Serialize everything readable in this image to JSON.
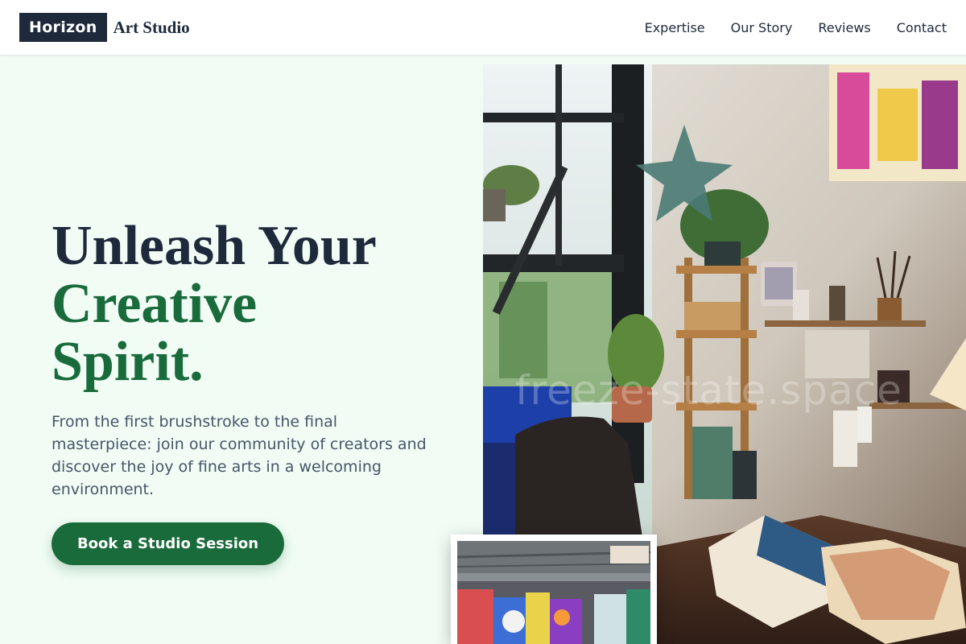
{
  "brand": {
    "name_box": "Horizon",
    "name_text": "Art Studio"
  },
  "nav": {
    "items": [
      {
        "label": "Expertise"
      },
      {
        "label": "Our Story"
      },
      {
        "label": "Reviews"
      },
      {
        "label": "Contact"
      }
    ]
  },
  "hero": {
    "headline_line1": "Unleash Your",
    "headline_line2": "Creative",
    "headline_line3": "Spirit.",
    "lead": "From the first brushstroke to the final masterpiece: join our community of creators and discover the joy of fine arts in a welcoming environment.",
    "cta_label": "Book a Studio Session"
  },
  "media": {
    "main_photo_icon": "art-studio-photo",
    "inset_photo_icon": "graffiti-studio-photo",
    "watermark": "freeze-state.space"
  },
  "colors": {
    "background": "#f0fcf4",
    "dark": "#1e293b",
    "accent_green": "#1a6b3c",
    "body_text": "#475569"
  }
}
